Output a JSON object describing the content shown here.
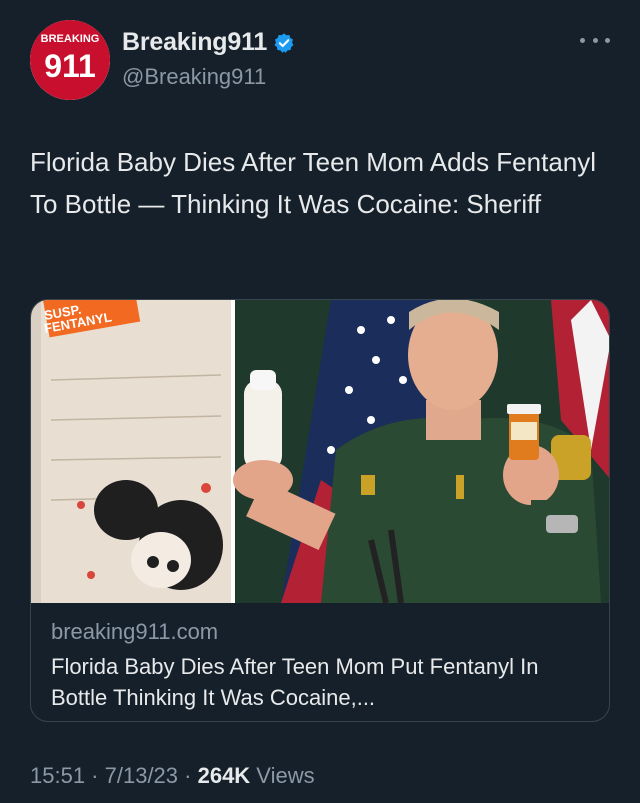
{
  "author": {
    "display_name": "Breaking911",
    "handle": "@Breaking911",
    "verified": true,
    "avatar_logo": {
      "top_text": "BREAKING",
      "number": "911"
    }
  },
  "tweet": {
    "text": "Florida Baby Dies After Teen Mom Adds Fentanyl To Bottle — Thinking It Was Cocaine: Sheriff"
  },
  "card": {
    "domain": "breaking911.com",
    "title": "Florida Baby Dies After Teen Mom Put Fentanyl In Bottle Thinking It Was Cocaine,...",
    "image_left_label": "SUSPECTED FENTANYL",
    "image_left_sublabel": "SUSPECTED FENTANYL"
  },
  "meta": {
    "time": "15:51",
    "separator_1": " · ",
    "date": "7/13/23",
    "separator_2": " · ",
    "views_count": "264K",
    "views_label": " Views"
  },
  "colors": {
    "background": "#15202b",
    "text_primary": "#e7e9ea",
    "text_secondary": "#8b98a5",
    "border": "#38444d",
    "verified_blue": "#1d9bf0",
    "logo_red": "#c8102e"
  },
  "icons": {
    "verified": "verified-badge-icon",
    "more": "more-options-icon"
  }
}
